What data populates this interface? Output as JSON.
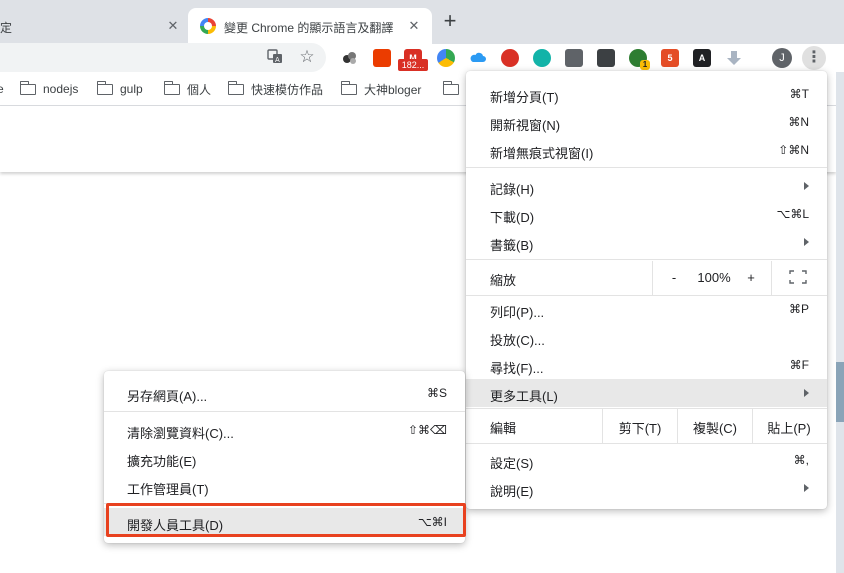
{
  "tabs": [
    {
      "title": "定",
      "close": "✕"
    },
    {
      "title": "變更 Chrome 的顯示語言及翻譯",
      "close": "✕"
    }
  ],
  "new_tab": "+",
  "toolbar": {
    "badge_count": "182...",
    "avatar_letter": "J",
    "menu_glyph": "⋮",
    "ext_badge": "1"
  },
  "bookmarks": [
    {
      "label": "e",
      "folder": false
    },
    {
      "label": "nodejs",
      "folder": true
    },
    {
      "label": "gulp",
      "folder": true
    },
    {
      "label": "個人",
      "folder": true
    },
    {
      "label": "快速模仿作品",
      "folder": true
    },
    {
      "label": "大神bloger",
      "folder": true
    }
  ],
  "main_menu": {
    "new_tab": {
      "label": "新增分頁(T)",
      "shortcut": "⌘T"
    },
    "new_window": {
      "label": "開新視窗(N)",
      "shortcut": "⌘N"
    },
    "incognito": {
      "label": "新增無痕式視窗(I)",
      "shortcut": "⇧⌘N"
    },
    "history": {
      "label": "記錄(H)"
    },
    "downloads": {
      "label": "下載(D)",
      "shortcut": "⌥⌘L"
    },
    "bookmarks": {
      "label": "書籤(B)"
    },
    "zoom": {
      "label": "縮放",
      "minus": "-",
      "value": "100%",
      "plus": "+"
    },
    "print": {
      "label": "列印(P)...",
      "shortcut": "⌘P"
    },
    "cast": {
      "label": "投放(C)..."
    },
    "find": {
      "label": "尋找(F)...",
      "shortcut": "⌘F"
    },
    "more_tools": {
      "label": "更多工具(L)"
    },
    "edit": {
      "label": "編輯",
      "cut": "剪下(T)",
      "copy": "複製(C)",
      "paste": "貼上(P)"
    },
    "settings": {
      "label": "設定(S)",
      "shortcut": "⌘,"
    },
    "help": {
      "label": "說明(E)"
    }
  },
  "more_tools_menu": {
    "save_page": {
      "label": "另存網頁(A)...",
      "shortcut": "⌘S"
    },
    "clear_data": {
      "label": "清除瀏覽資料(C)...",
      "shortcut": "⇧⌘⌫"
    },
    "extensions": {
      "label": "擴充功能(E)"
    },
    "task_manager": {
      "label": "工作管理員(T)"
    },
    "dev_tools": {
      "label": "開發人員工具(D)",
      "shortcut": "⌥⌘I"
    }
  },
  "colors": {
    "highlight_border": "#e8411f",
    "menu_hover": "#e8e8e8",
    "tabstrip": "#dee1e6"
  }
}
